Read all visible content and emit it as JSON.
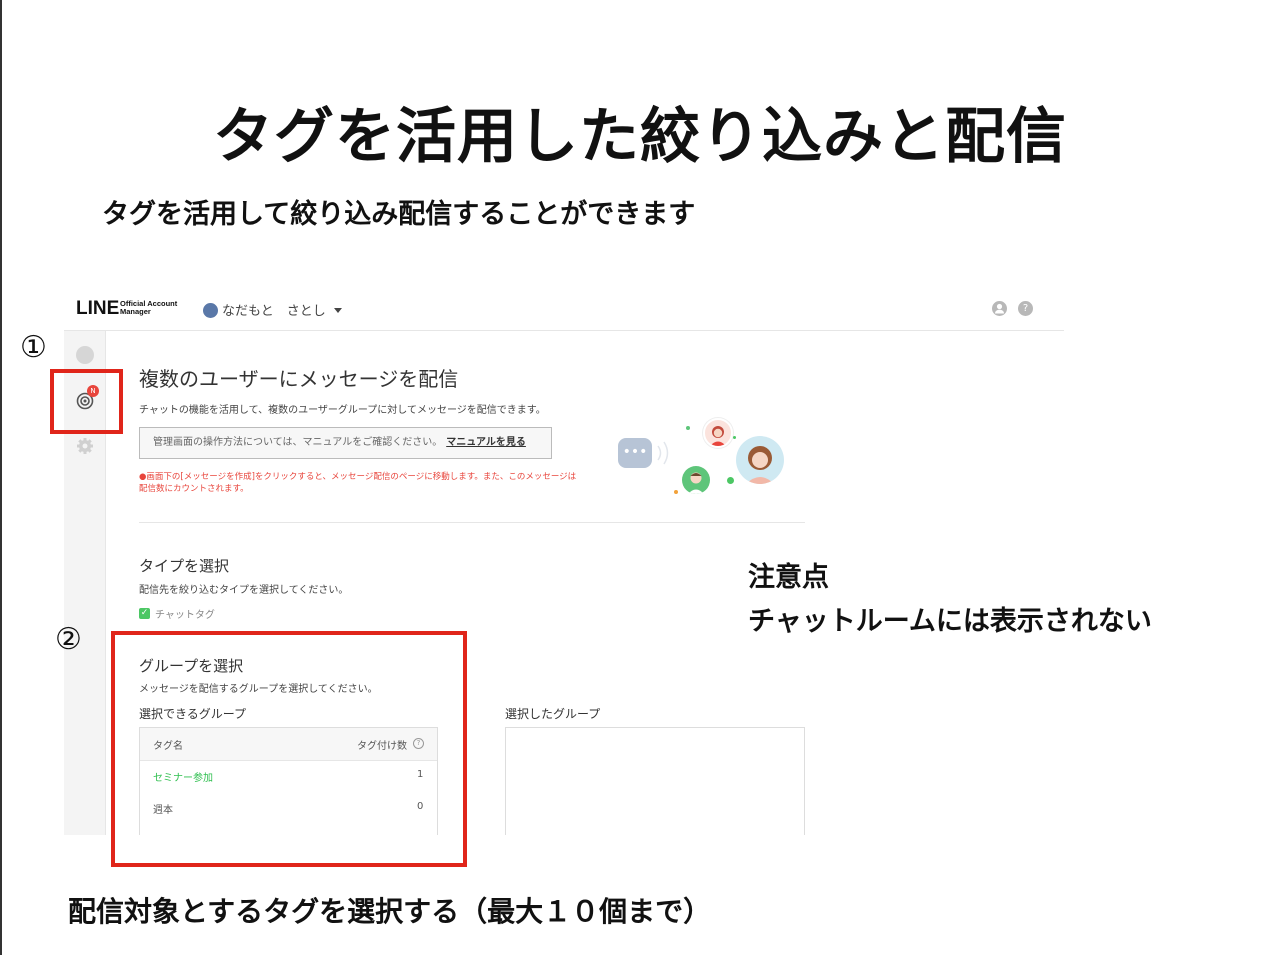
{
  "slide": {
    "title": "タグを活用した絞り込みと配信",
    "subtitle": "タグを活用して絞り込み配信することができます",
    "marker1": "①",
    "marker2": "②",
    "caution_title": "注意点",
    "caution_body": "チャットルームには表示されない",
    "bottom_note": "配信対象とするタグを選択する（最大１０個まで）"
  },
  "app": {
    "logo_main": "LINE",
    "logo_sub_line1": "Official Account",
    "logo_sub_line2": "Manager",
    "account_name": "なだもと　さとし",
    "help_icon_glyph": "?",
    "notification_badge": "N",
    "page_title": "複数のユーザーにメッセージを配信",
    "page_desc": "チャットの機能を活用して、複数のユーザーグループに対してメッセージを配信できます。",
    "manual_text": "管理画面の操作方法については、マニュアルをご確認ください。",
    "manual_link": "マニュアルを見る",
    "warning": "●画面下の[メッセージを作成]をクリックすると、メッセージ配信のページに移動します。また、このメッセージは配信数にカウントされます。",
    "type_section": {
      "title": "タイプを選択",
      "desc": "配信先を絞り込むタイプを選択してください。",
      "option_label": "チャットタグ",
      "option_checked": true
    },
    "group_section": {
      "title": "グループを選択",
      "desc": "メッセージを配信するグループを選択してください。",
      "available_label": "選択できるグループ",
      "selected_label": "選択したグループ",
      "columns": [
        "タグ名",
        "タグ付け数"
      ],
      "rows": [
        {
          "name": "セミナー参加",
          "count": "1"
        },
        {
          "name": "週本",
          "count": "0"
        }
      ]
    }
  },
  "icons": [
    "chat-icon",
    "broadcast-icon",
    "gear-icon",
    "user-icon",
    "help-icon",
    "globe-icon",
    "info-icon"
  ],
  "colors": {
    "highlight_red": "#e0251a",
    "line_green": "#4cc764",
    "warning_red": "#e8453c"
  }
}
